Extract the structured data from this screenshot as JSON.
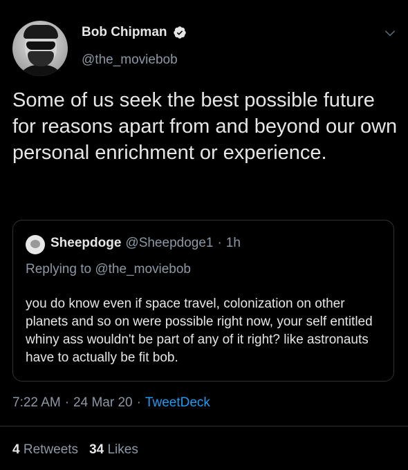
{
  "author": {
    "name": "Bob Chipman",
    "handle": "@the_moviebob",
    "verified_icon": "verified-badge-icon",
    "avatar_icon": "avatar-photo"
  },
  "tweet": {
    "text": "Some of us seek the best possible future for reasons apart from and beyond our own personal enrichment or experience."
  },
  "quoted": {
    "name": "Sheepdoge",
    "handle": "@Sheepdoge1",
    "separator": "·",
    "age": "1h",
    "reply_prefix": "Replying to",
    "reply_to": "@the_moviebob",
    "text": "you do know even if space travel, colonization on other planets and so on were possible right now, your self entitled whiny ass wouldn't be part of any of it right? like astronauts have to actually be fit bob."
  },
  "meta": {
    "time": "7:22 AM",
    "sep1": "·",
    "date": "24 Mar 20",
    "sep2": "·",
    "source": "TweetDeck"
  },
  "stats": {
    "retweets_count": "4",
    "retweets_label": "Retweets",
    "likes_count": "34",
    "likes_label": "Likes"
  },
  "colors": {
    "background": "#000000",
    "text": "#e6e6e6",
    "secondary": "#8b98a5",
    "link": "#1d9bf0",
    "border": "#2f3336"
  }
}
